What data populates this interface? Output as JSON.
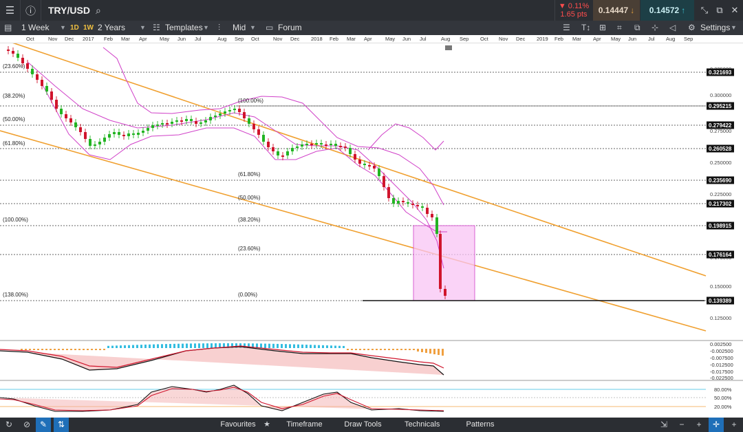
{
  "header": {
    "menu_icon": "hamburger-icon",
    "info_icon": "info-icon",
    "symbol": "TRY/USD",
    "search_icon": "search-icon",
    "change_pct": "▼ 0.11%",
    "change_pts": "1.65 pts",
    "bid": "0.14447",
    "ask": "0.14572",
    "bid_color": "#e0a040",
    "ask_color": "#3ec6d6",
    "window_icons": [
      "collapse-icon",
      "popout-icon",
      "close-icon"
    ]
  },
  "toolbar": {
    "interval": "1 Week",
    "tf_1d": "1D",
    "tf_1w": "1W",
    "range": "2 Years",
    "templates": "Templates",
    "price_type": "Mid",
    "forum": "Forum",
    "settings": "Settings"
  },
  "time_axis": [
    "Oct",
    "Nov",
    "Dec",
    "2017",
    "Feb",
    "Mar",
    "Apr",
    "May",
    "Jun",
    "Jul",
    "Aug",
    "Sep",
    "Oct",
    "Nov",
    "Dec",
    "2018",
    "Feb",
    "Mar",
    "Apr",
    "May",
    "Jun",
    "Jul",
    "Aug",
    "Sep",
    "Oct",
    "Nov",
    "Dec",
    "2019",
    "Feb",
    "Mar",
    "Apr",
    "May",
    "Jun",
    "Jul",
    "Aug",
    "Sep"
  ],
  "price_axis": {
    "scale_labels": [
      "0.325000",
      "0.300000",
      "0.275000",
      "0.250000",
      "0.225000",
      "0.200000",
      "0.175000",
      "0.150000",
      "0.125000"
    ],
    "boxed_labels": [
      "0.321693",
      "0.295215",
      "0.279422",
      "0.260528",
      "0.235690",
      "0.217302",
      "0.198915",
      "0.176164",
      "0.139389"
    ]
  },
  "fib_left": [
    "(23.60%)",
    "(38.20%)",
    "(50.00%)",
    "(61.80%)",
    "(100.00%)",
    "(138.00%)"
  ],
  "fib_right": [
    "(100.00%)",
    "(61.80%)",
    "(50.00%)",
    "(38.20%)",
    "(23.60%)",
    "(0.00%)"
  ],
  "macd_axis": [
    "0.002500",
    "-0.002500",
    "-0.007500",
    "-0.012500",
    "-0.017500",
    "-0.022500"
  ],
  "stoch_axis": [
    "80.00%",
    "50.00%",
    "20.00%"
  ],
  "bottom": {
    "favourites": "Favourites",
    "timeframe": "Timeframe",
    "draw_tools": "Draw Tools",
    "technicals": "Technicals",
    "patterns": "Patterns"
  },
  "colors": {
    "up": "#22b422",
    "down": "#d0142c",
    "bollinger": "#d040c8",
    "trendline": "#f0a030",
    "highlight_box": "#f4b8f0"
  }
}
